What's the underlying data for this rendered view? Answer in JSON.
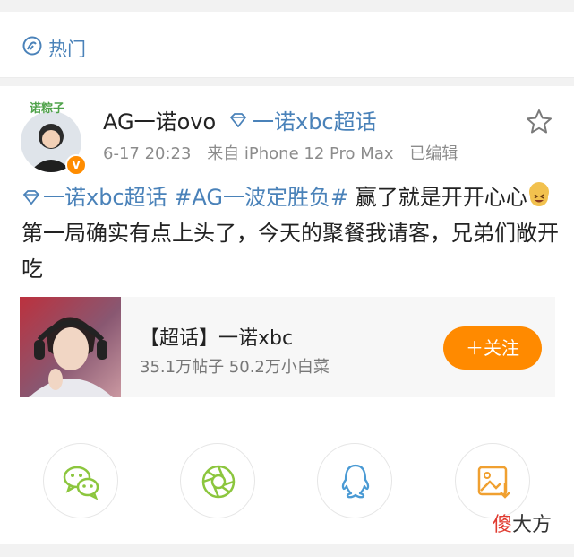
{
  "section": {
    "title": "热门",
    "icon": "hot-topic-icon"
  },
  "post": {
    "author": {
      "name": "AG一诺ovo",
      "avatar_caption": "诺粽子",
      "verified_badge": "V"
    },
    "topic_tag": "一诺xbc超话",
    "meta": {
      "time": "6-17 20:23",
      "source": "来自 iPhone 12 Pro Max",
      "status": "已编辑"
    },
    "text": {
      "topic_link": "一诺xbc超话",
      "hashtag": "#AG一波定胜负#",
      "part1": " 赢了就是开开心心",
      "part2": "第一局确实有点上头了，今天的聚餐我请客，兄弟们敞开吃"
    }
  },
  "topic_card": {
    "title": "【超话】一诺xbc",
    "stats": "35.1万帖子  50.2万小白菜",
    "follow_label": "＋关注"
  },
  "share": {
    "items": [
      "wechat-icon",
      "moments-icon",
      "qq-icon",
      "save-image-icon"
    ]
  },
  "watermark": {
    "char1": "傻",
    "rest": "大方"
  },
  "colors": {
    "link": "#4a82b9",
    "accent": "#ff8a00",
    "green": "#8cc63e"
  }
}
